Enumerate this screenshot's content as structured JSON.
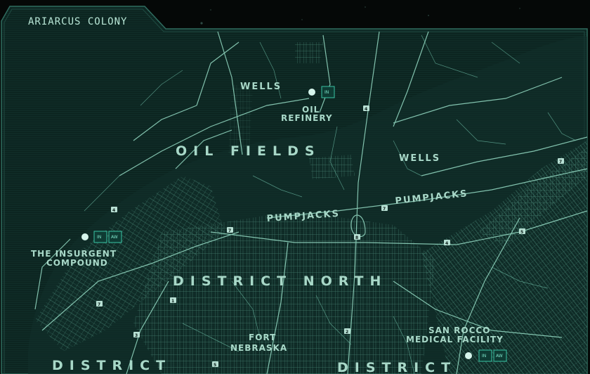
{
  "header": {
    "title": "ARIARCUS COLONY"
  },
  "colors": {
    "background": "#0f2b26",
    "line": "#7fcab4",
    "text": "#a8d8c8",
    "accent": "#39c4a4"
  },
  "labels": {
    "oil_fields": "OIL FIELDS",
    "wells_north": "WELLS",
    "wells_east": "WELLS",
    "oil_refinery_1": "OIL",
    "oil_refinery_2": "REFINERY",
    "pumpjacks_west": "PUMPJACKS",
    "pumpjacks_east": "PUMPJACKS",
    "insurgent_1": "THE INSURGENT",
    "insurgent_2": "COMPOUND",
    "district_north": "DISTRICT NORTH",
    "fort_1": "FORT",
    "fort_2": "NEBRASKA",
    "medical_1": "SAN ROCCO",
    "medical_2": "MEDICAL FACILITY",
    "district_sw": "DISTRICT",
    "district_s": "DISTRICT"
  },
  "badges": {
    "in": "IN",
    "aw": "AW"
  },
  "routes": [
    "4",
    "7",
    "8",
    "4",
    "7",
    "7",
    "4",
    "5",
    "1",
    "7",
    "3",
    "2",
    "5"
  ],
  "icons": [
    "location-pin-icon",
    "route-marker-icon",
    "facility-badge-icon"
  ]
}
